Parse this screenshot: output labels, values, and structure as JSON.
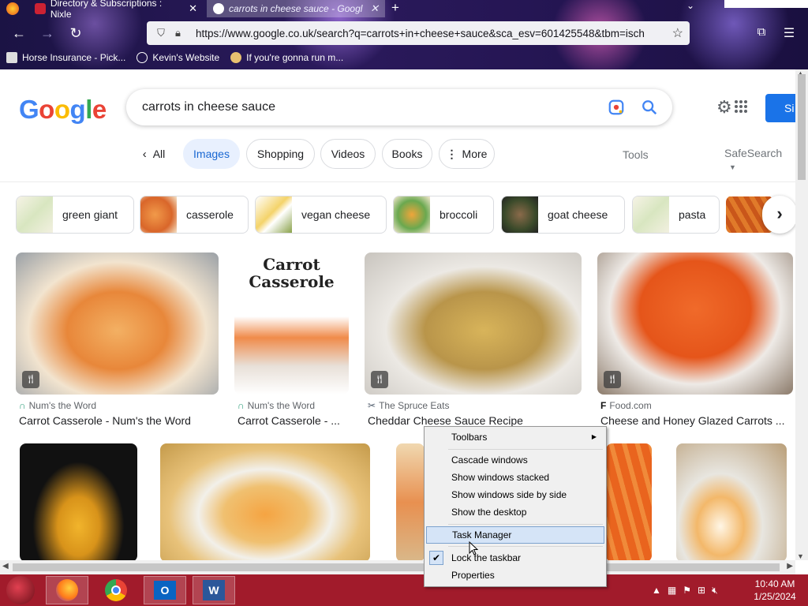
{
  "browser": {
    "tabs": [
      {
        "title": "Directory & Subscriptions : Nixle",
        "active": false
      },
      {
        "title": "carrots in cheese sauce - Googl",
        "active": true
      }
    ],
    "url": "https://www.google.co.uk/search?q=carrots+in+cheese+sauce&sca_esv=601425548&tbm=isch",
    "bookmarks": [
      "Horse Insurance - Pick...",
      "Kevin's Website",
      "If you're gonna run m..."
    ]
  },
  "google": {
    "logo_letters": [
      "G",
      "o",
      "o",
      "g",
      "l",
      "e"
    ],
    "query": "carrots in cheese sauce",
    "signin_label": "Si",
    "filters": {
      "all": "All",
      "images": "Images",
      "shopping": "Shopping",
      "videos": "Videos",
      "books": "Books",
      "more": "More",
      "tools": "Tools",
      "safesearch": "SafeSearch"
    },
    "related": [
      "green giant",
      "casserole",
      "vegan cheese",
      "broccoli",
      "goat cheese",
      "pasta"
    ],
    "results_row1": [
      {
        "source": "Num's the Word",
        "title": "Carrot Casserole - Num's the Word"
      },
      {
        "source": "Num's the Word",
        "title": "Carrot Casserole - ...",
        "overlay_text": "Carrot Casserole"
      },
      {
        "source": "The Spruce Eats",
        "title": "Cheddar Cheese Sauce Recipe"
      },
      {
        "source": "Food.com",
        "title": "Cheese and Honey Glazed Carrots ..."
      }
    ]
  },
  "context_menu": {
    "items": [
      {
        "label": "Toolbars",
        "submenu": true
      },
      {
        "label": "Cascade windows"
      },
      {
        "label": "Show windows stacked"
      },
      {
        "label": "Show windows side by side"
      },
      {
        "label": "Show the desktop"
      },
      {
        "label": "Task Manager",
        "highlighted": true
      },
      {
        "label": "Lock the taskbar",
        "checked": true
      },
      {
        "label": "Properties"
      }
    ]
  },
  "taskbar": {
    "apps": [
      "firefox-icon",
      "chrome-icon",
      "outlook-icon",
      "word-icon"
    ],
    "time": "10:40 AM",
    "date": "1/25/2024"
  },
  "colors": {
    "accent_blue": "#1a73e8",
    "taskbar": "#a11b2b",
    "chip_selected_bg": "#e8f0fe"
  }
}
